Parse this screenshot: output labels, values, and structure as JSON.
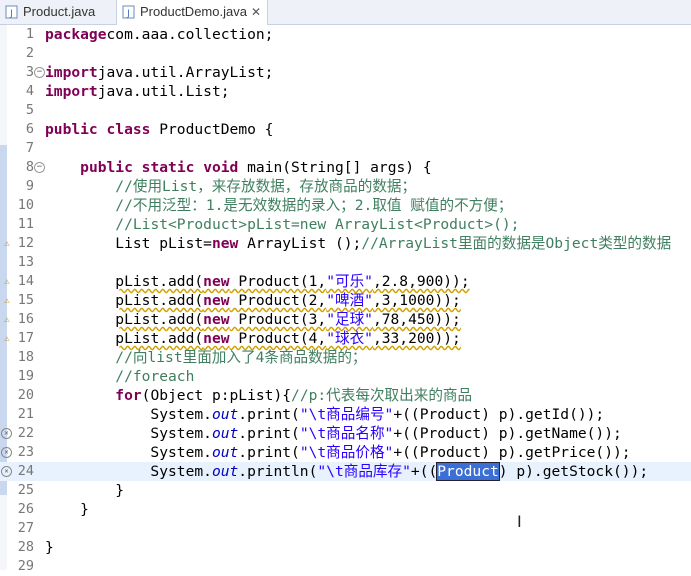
{
  "tabs": [
    {
      "label": "Product.java",
      "close": ""
    },
    {
      "label": "ProductDemo.java",
      "close": "✕"
    }
  ],
  "lines": [
    {
      "n": "1",
      "tokens": [
        [
          "kw",
          "package"
        ],
        [
          "",
          "com.aaa.collection;"
        ]
      ]
    },
    {
      "n": "2",
      "tokens": []
    },
    {
      "n": "3",
      "fold": "−",
      "tokens": [
        [
          "kw",
          "import"
        ],
        [
          "",
          "java.util.ArrayList;"
        ]
      ]
    },
    {
      "n": "4",
      "tokens": [
        [
          "kw",
          "import"
        ],
        [
          "",
          "java.util.List;"
        ]
      ]
    },
    {
      "n": "5",
      "tokens": []
    },
    {
      "n": "6",
      "tokens": [
        [
          "kw",
          "public"
        ],
        [
          "",
          " "
        ],
        [
          "kw",
          "class"
        ],
        [
          "",
          " ProductDemo {"
        ]
      ]
    },
    {
      "n": "7",
      "tokens": []
    },
    {
      "n": "8",
      "fold": "−",
      "tokens": [
        [
          "",
          "    "
        ],
        [
          "kw",
          "public"
        ],
        [
          "",
          " "
        ],
        [
          "kw",
          "static"
        ],
        [
          "",
          " "
        ],
        [
          "kw",
          "void"
        ],
        [
          "",
          " main(String[] args) {"
        ]
      ]
    },
    {
      "n": "9",
      "tokens": [
        [
          "",
          "        "
        ],
        [
          "cm",
          "//使用List，来存放数据，存放商品的数据；"
        ]
      ]
    },
    {
      "n": "10",
      "tokens": [
        [
          "",
          "        "
        ],
        [
          "cm",
          "//不用泛型：1.是无效数据的录入；2.取值 赋值的不方便；"
        ]
      ]
    },
    {
      "n": "11",
      "tokens": [
        [
          "",
          "        "
        ],
        [
          "cm",
          "//List<Product>pList=new ArrayList<Product>();"
        ]
      ]
    },
    {
      "n": "12",
      "marker": "warn",
      "tokens": [
        [
          "",
          "        List pList="
        ],
        [
          "kw",
          "new"
        ],
        [
          "",
          " ArrayList ();"
        ],
        [
          "cm",
          "//ArrayList里面的数据是Object类型的数据"
        ]
      ]
    },
    {
      "n": "13",
      "tokens": []
    },
    {
      "n": "14",
      "marker": "warn",
      "tokens": [
        [
          "",
          "        "
        ],
        [
          "warn",
          "pList.add("
        ],
        [
          "kw warn",
          "new"
        ],
        [
          "warn",
          " Product(1,"
        ],
        [
          "str warn",
          "\"可乐\""
        ],
        [
          "warn",
          ",2.8,900));"
        ]
      ]
    },
    {
      "n": "15",
      "marker": "warn",
      "tokens": [
        [
          "",
          "        "
        ],
        [
          "warn",
          "pList.add("
        ],
        [
          "kw warn",
          "new"
        ],
        [
          "warn",
          " Product(2,"
        ],
        [
          "str warn",
          "\"啤酒\""
        ],
        [
          "warn",
          ",3,1000));"
        ]
      ]
    },
    {
      "n": "16",
      "marker": "warn",
      "tokens": [
        [
          "",
          "        "
        ],
        [
          "warn",
          "pList.add("
        ],
        [
          "kw warn",
          "new"
        ],
        [
          "warn",
          " Product(3,"
        ],
        [
          "str warn",
          "\"足球\""
        ],
        [
          "warn",
          ",78,450));"
        ]
      ]
    },
    {
      "n": "17",
      "marker": "warn",
      "tokens": [
        [
          "",
          "        "
        ],
        [
          "warn",
          "pList.add("
        ],
        [
          "kw warn",
          "new"
        ],
        [
          "warn",
          " Product(4,"
        ],
        [
          "str warn",
          "\"球衣\""
        ],
        [
          "warn",
          ",33,200));"
        ]
      ]
    },
    {
      "n": "18",
      "tokens": [
        [
          "",
          "        "
        ],
        [
          "cm",
          "//向list里面加入了4条商品数据的；"
        ]
      ]
    },
    {
      "n": "19",
      "tokens": [
        [
          "",
          "        "
        ],
        [
          "cm",
          "//foreach"
        ]
      ]
    },
    {
      "n": "20",
      "tokens": [
        [
          "",
          "        "
        ],
        [
          "kw",
          "for"
        ],
        [
          "",
          "(Object p:pList){"
        ],
        [
          "cm",
          "//p:代表每次取出来的商品"
        ]
      ]
    },
    {
      "n": "21",
      "tokens": [
        [
          "",
          "            System."
        ],
        [
          "fld",
          "out"
        ],
        [
          "",
          ".print("
        ],
        [
          "str",
          "\"\\t商品编号\""
        ],
        [
          "",
          "+((Product) p).getId());"
        ]
      ]
    },
    {
      "n": "22",
      "marker": "err",
      "tokens": [
        [
          "",
          "            System."
        ],
        [
          "fld",
          "out"
        ],
        [
          "",
          ".print("
        ],
        [
          "str",
          "\"\\t商品名称\""
        ],
        [
          "",
          "+((Product) p).getName());"
        ]
      ]
    },
    {
      "n": "23",
      "marker": "err",
      "tokens": [
        [
          "",
          "            System."
        ],
        [
          "fld",
          "out"
        ],
        [
          "",
          ".print("
        ],
        [
          "str",
          "\"\\t商品价格\""
        ],
        [
          "",
          "+((Product) p).getPrice());"
        ]
      ]
    },
    {
      "n": "24",
      "marker": "err",
      "current": true,
      "tokens": [
        [
          "",
          "            System."
        ],
        [
          "fld",
          "out"
        ],
        [
          "",
          ".println("
        ],
        [
          "str",
          "\"\\t商品库存\""
        ],
        [
          "",
          "+(("
        ],
        [
          "sel",
          "Product"
        ],
        [
          "",
          ") p).getStock());"
        ]
      ]
    },
    {
      "n": "25",
      "tokens": [
        [
          "",
          "        }"
        ]
      ]
    },
    {
      "n": "26",
      "tokens": [
        [
          "",
          "    }"
        ]
      ]
    },
    {
      "n": "27",
      "tokens": []
    },
    {
      "n": "28",
      "tokens": [
        [
          "",
          "}"
        ]
      ]
    },
    {
      "n": "29",
      "tokens": []
    }
  ],
  "icons": {
    "tab_file": "java-file-icon",
    "warning": "warning-icon",
    "error": "error-icon",
    "cursor": "text-cursor-icon"
  },
  "colors": {
    "keyword": "#7f0055",
    "comment": "#3f7f5f",
    "string": "#2a00ff",
    "field": "#0000c0",
    "selection": "#3b6fd6",
    "current_line": "#e8f2fe"
  }
}
